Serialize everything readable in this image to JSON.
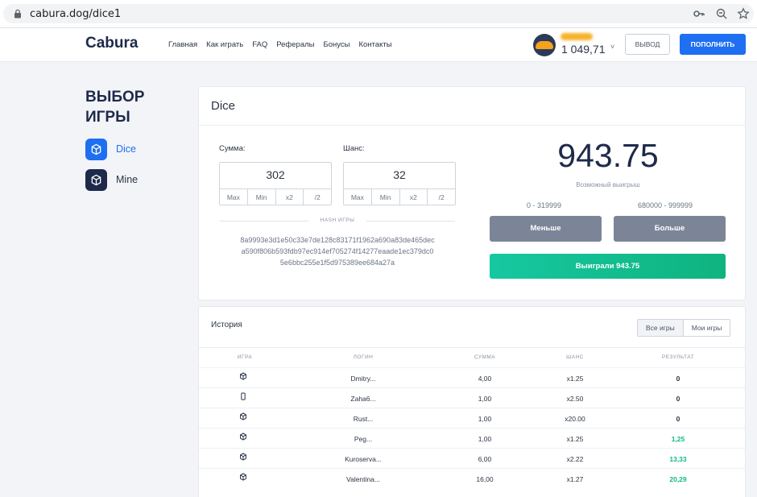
{
  "browser": {
    "url": "cabura.dog/dice1",
    "icons": [
      "lock-icon",
      "key-icon",
      "zoom-icon",
      "star-icon"
    ]
  },
  "header": {
    "logo": "Cabura",
    "nav": [
      "Главная",
      "Как играть",
      "FAQ",
      "Рефералы",
      "Бонусы",
      "Контакты"
    ],
    "balance": "1 049,71",
    "caret": "˅",
    "withdraw_label": "ВЫВОД",
    "deposit_label": "ПОПОЛНИТЬ"
  },
  "sidebar": {
    "title": "ВЫБОР ИГРЫ",
    "items": [
      {
        "label": "Dice",
        "icon": "cube-icon",
        "color": "#1e6ff1"
      },
      {
        "label": "Mine",
        "icon": "cube-icon",
        "color": "#1e2a4a"
      }
    ]
  },
  "dice": {
    "title": "Dice",
    "amount_label": "Сумма:",
    "amount_value": "302",
    "chance_label": "Шанс:",
    "chance_value": "32",
    "quick_buttons": [
      "Max",
      "Min",
      "x2",
      "/2"
    ],
    "hash_label": "HASH ИГРЫ",
    "hash_lines": [
      "8a9993e3d1e50c33e7de128c83171f1962a690a83de465dec",
      "a590f806b593fdb97ec914ef705274f14277eaade1ec379dc0",
      "5e6bbc255e1f5d975389ee684a27a"
    ],
    "possible_win": "943.75",
    "possible_win_label": "Возможный выигрыш",
    "range_low": "0 - 319999",
    "range_high": "680000 - 999999",
    "less_label": "Меньше",
    "more_label": "Больше",
    "result_label": "Выиграли 943.75"
  },
  "history": {
    "title": "История",
    "tabs": [
      "Все игры",
      "Мои игры"
    ],
    "columns": [
      "ИГРА",
      "ЛОГИН",
      "СУММА",
      "ШАНС",
      "РЕЗУЛЬТАТ"
    ],
    "rows": [
      {
        "game_icon": "cube-icon",
        "login": "Dmitry...",
        "amount": "4,00",
        "chance": "x1.25",
        "result": "0",
        "win": false
      },
      {
        "game_icon": "phone-icon",
        "login": "Zaha6...",
        "amount": "1,00",
        "chance": "x2.50",
        "result": "0",
        "win": false
      },
      {
        "game_icon": "cube-icon",
        "login": "Rust...",
        "amount": "1,00",
        "chance": "x20.00",
        "result": "0",
        "win": false
      },
      {
        "game_icon": "cube-icon",
        "login": "Peg...",
        "amount": "1,00",
        "chance": "x1.25",
        "result": "1,25",
        "win": true
      },
      {
        "game_icon": "cube-icon",
        "login": "Kuroserva...",
        "amount": "6,00",
        "chance": "x2.22",
        "result": "13,33",
        "win": true
      },
      {
        "game_icon": "cube-icon",
        "login": "Valentina...",
        "amount": "16,00",
        "chance": "x1.27",
        "result": "20,29",
        "win": true
      }
    ]
  },
  "colors": {
    "accent": "#1e6ff1",
    "win": "#12b886",
    "dark": "#1e2a4a",
    "grey_button": "#7c8598"
  }
}
